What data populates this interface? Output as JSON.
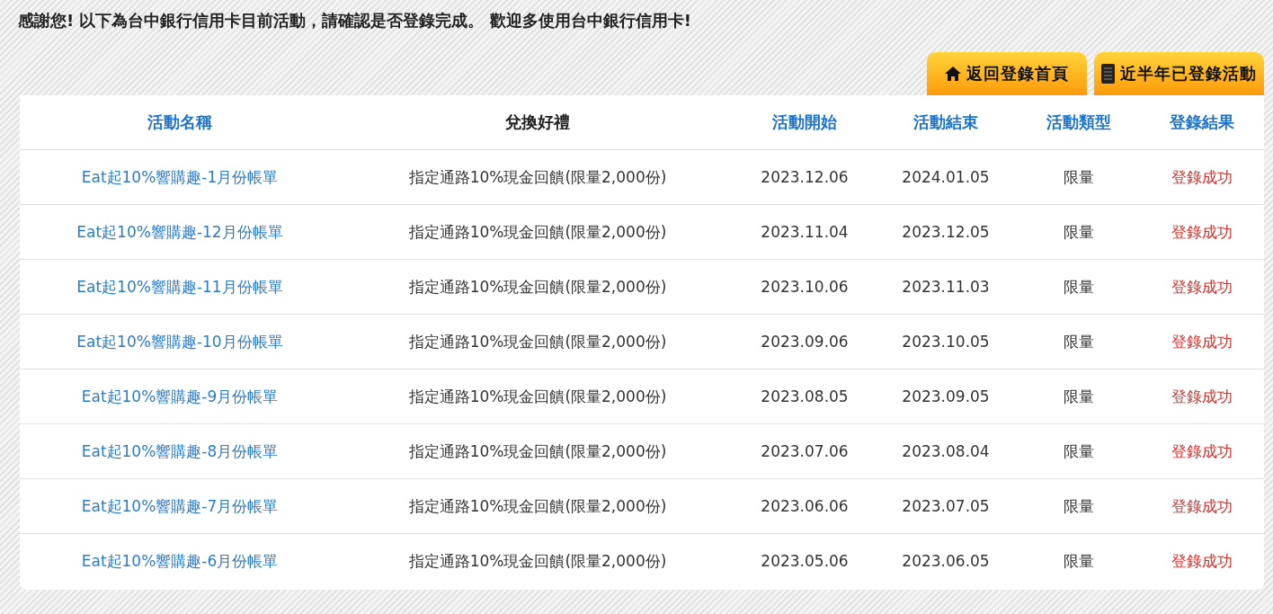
{
  "message": "感謝您! 以下為台中銀行信用卡目前活動，請確認是否登錄完成。 歡迎多使用台中銀行信用卡!",
  "buttons": [
    "返回登錄首頁",
    "近半年已登錄活動"
  ],
  "table": {
    "columns": [
      "活動名稱",
      "兌換好禮",
      "活動開始",
      "活動結束",
      "活動類型",
      "登錄結果"
    ],
    "rows": [
      [
        "Eat起10%響購趣-1月份帳單",
        "指定通路10%現金回饋(限量2,000份)",
        "2023.12.06",
        "2024.01.05",
        "限量",
        "登錄成功"
      ],
      [
        "Eat起10%響購趣-12月份帳單",
        "指定通路10%現金回饋(限量2,000份)",
        "2023.11.04",
        "2023.12.05",
        "限量",
        "登錄成功"
      ],
      [
        "Eat起10%響購趣-11月份帳單",
        "指定通路10%現金回饋(限量2,000份)",
        "2023.10.06",
        "2023.11.03",
        "限量",
        "登錄成功"
      ],
      [
        "Eat起10%響購趣-10月份帳單",
        "指定通路10%現金回饋(限量2,000份)",
        "2023.09.06",
        "2023.10.05",
        "限量",
        "登錄成功"
      ],
      [
        "Eat起10%響購趣-9月份帳單",
        "指定通路10%現金回饋(限量2,000份)",
        "2023.08.05",
        "2023.09.05",
        "限量",
        "登錄成功"
      ],
      [
        "Eat起10%響購趣-8月份帳單",
        "指定通路10%現金回饋(限量2,000份)",
        "2023.07.06",
        "2023.08.04",
        "限量",
        "登錄成功"
      ],
      [
        "Eat起10%響購趣-7月份帳單",
        "指定通路10%現金回饋(限量2,000份)",
        "2023.06.06",
        "2023.07.05",
        "限量",
        "登錄成功"
      ],
      [
        "Eat起10%響購趣-6月份帳單",
        "指定通路10%現金回饋(限量2,000份)",
        "2023.05.06",
        "2023.06.05",
        "限量",
        "登錄成功"
      ]
    ]
  }
}
